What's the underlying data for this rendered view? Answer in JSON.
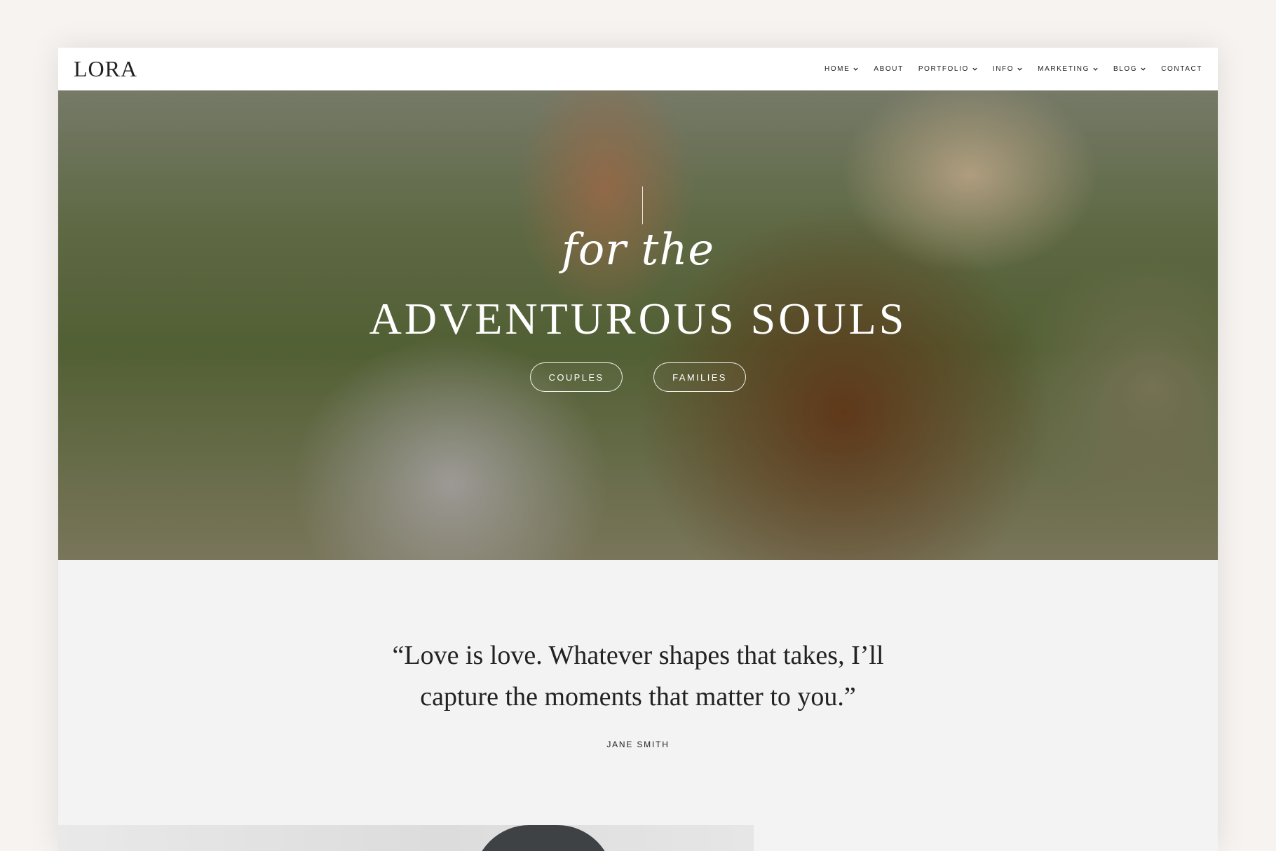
{
  "brand": {
    "logo": "LORA"
  },
  "nav": {
    "items": [
      {
        "label": "HOME",
        "dropdown": true
      },
      {
        "label": "ABOUT",
        "dropdown": false
      },
      {
        "label": "PORTFOLIO",
        "dropdown": true
      },
      {
        "label": "INFO",
        "dropdown": true
      },
      {
        "label": "MARKETING",
        "dropdown": true
      },
      {
        "label": "BLOG",
        "dropdown": true
      },
      {
        "label": "CONTACT",
        "dropdown": false
      }
    ]
  },
  "hero": {
    "script": "for the",
    "title": "ADVENTUROUS SOULS",
    "buttons": [
      {
        "label": "COUPLES"
      },
      {
        "label": "FAMILIES"
      }
    ]
  },
  "testimonial": {
    "quote_line1": "“Love is love. Whatever shapes that takes, I’ll",
    "quote_line2": "capture the moments that matter to you.”",
    "author": "JANE SMITH"
  },
  "icons": {
    "dropdown": "chevron-down-icon"
  }
}
